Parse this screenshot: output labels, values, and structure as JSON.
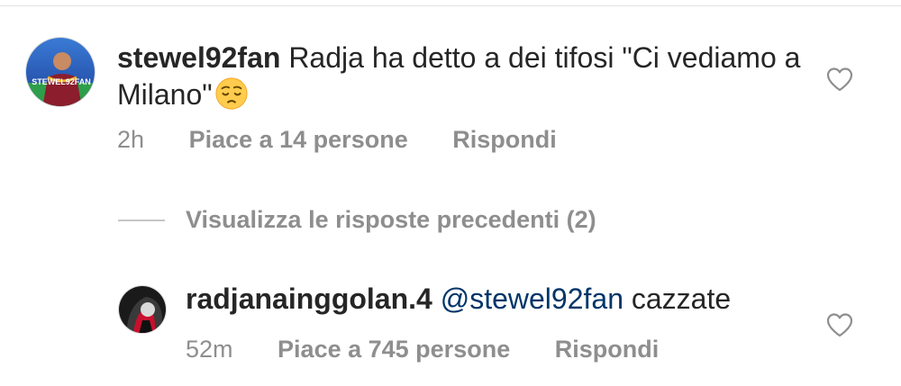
{
  "comments": [
    {
      "username": "stewel92fan",
      "text": "Radja ha detto a dei tifosi \"Ci vediamo a Milano\"",
      "emoji": "pensive-face",
      "avatar_label": "STEWEL92FAN",
      "time": "2h",
      "likes": "Piace a 14 persone",
      "reply_label": "Rispondi"
    }
  ],
  "view_previous_replies": "Visualizza le risposte precedenti (2)",
  "replies": [
    {
      "username": "radjanainggolan.4",
      "mention": "@stewel92fan",
      "text": "cazzate",
      "time": "52m",
      "likes": "Piace a 745 persone",
      "reply_label": "Rispondi"
    }
  ],
  "colors": {
    "primary_text": "#262626",
    "secondary_text": "#8e8e8e",
    "mention": "#003569",
    "divider": "#e4e4e4"
  },
  "icons": {
    "like": "heart-outline-icon",
    "emoji": "pensive-face-emoji"
  }
}
